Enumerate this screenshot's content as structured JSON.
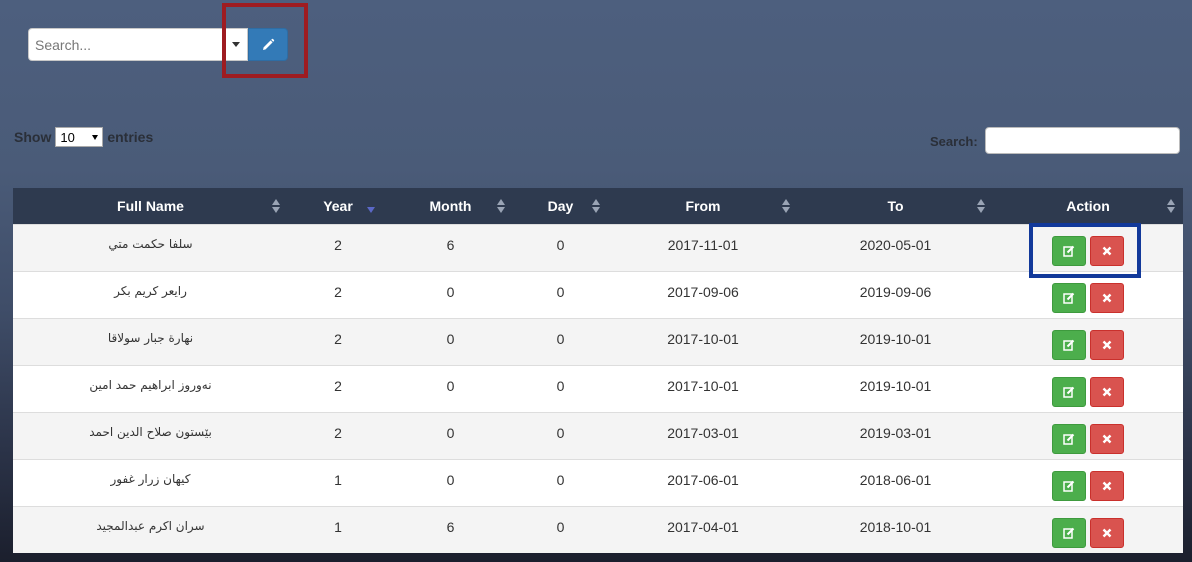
{
  "top_search": {
    "placeholder": "Search..."
  },
  "length_menu": {
    "prefix": "Show",
    "value": "10",
    "suffix": "entries"
  },
  "filter": {
    "label": "Search:"
  },
  "table": {
    "columns": [
      "Full Name",
      "Year",
      "Month",
      "Day",
      "From",
      "To",
      "Action"
    ],
    "sorted_column": "Year",
    "rows": [
      {
        "name": "سلفا حكمت متي",
        "year": "2",
        "month": "6",
        "day": "0",
        "from": "2017-11-01",
        "to": "2020-05-01"
      },
      {
        "name": "رايعر كريم بكر",
        "year": "2",
        "month": "0",
        "day": "0",
        "from": "2017-09-06",
        "to": "2019-09-06"
      },
      {
        "name": "نهارة جبار سولاقا",
        "year": "2",
        "month": "0",
        "day": "0",
        "from": "2017-10-01",
        "to": "2019-10-01"
      },
      {
        "name": "نەوروز ابراهيم حمد امين",
        "year": "2",
        "month": "0",
        "day": "0",
        "from": "2017-10-01",
        "to": "2019-10-01"
      },
      {
        "name": "بێستون صلاح الدين احمد",
        "year": "2",
        "month": "0",
        "day": "0",
        "from": "2017-03-01",
        "to": "2019-03-01"
      },
      {
        "name": "كيهان زرار غفور",
        "year": "1",
        "month": "0",
        "day": "0",
        "from": "2017-06-01",
        "to": "2018-06-01"
      },
      {
        "name": "سران اكرم عبدالمجيد",
        "year": "1",
        "month": "6",
        "day": "0",
        "from": "2017-04-01",
        "to": "2018-10-01"
      }
    ]
  },
  "icons": {
    "top_edit": "pencil-icon",
    "row_edit": "edit-icon",
    "row_delete": "delete-x-icon"
  },
  "colors": {
    "header_bg": "#2e3a4f",
    "primary": "#337ab7",
    "success": "#4cae4c",
    "danger": "#d9534f",
    "highlight_red": "#9e1c21",
    "highlight_blue": "#12399a"
  }
}
